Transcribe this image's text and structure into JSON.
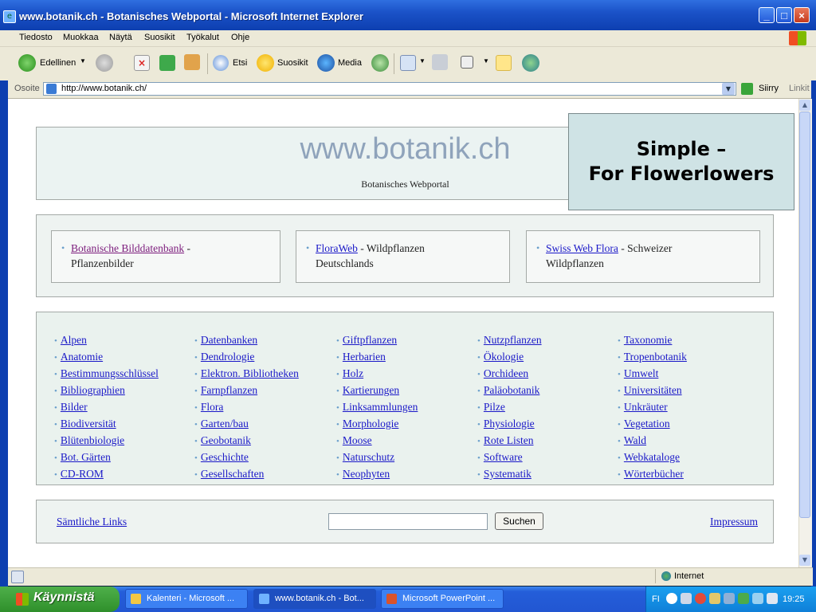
{
  "window": {
    "title": "www.botanik.ch - Botanisches Webportal - Microsoft Internet Explorer",
    "min_label": "_",
    "max_label": "□",
    "close_label": "×"
  },
  "menu": [
    "Tiedosto",
    "Muokkaa",
    "Näytä",
    "Suosikit",
    "Työkalut",
    "Ohje"
  ],
  "toolbar": {
    "back_label": "Edellinen",
    "search_label": "Etsi",
    "favorites_label": "Suosikit",
    "media_label": "Media"
  },
  "address": {
    "label": "Osoite",
    "url": "http://www.botanik.ch/",
    "go_label": "Siirry",
    "links_label": "Linkit"
  },
  "page": {
    "site_title": "www.botanik.ch",
    "site_subtitle": "Botanisches Webportal",
    "features": [
      {
        "link": "Botanische Bilddatenbank",
        "rest": " - ",
        "line2": "Pflanzenbilder",
        "visited": true
      },
      {
        "link": "FloraWeb",
        "rest": " - Wildpflanzen",
        "line2": "Deutschlands",
        "visited": false
      },
      {
        "link": "Swiss Web Flora",
        "rest": " - Schweizer",
        "line2": "Wildpflanzen",
        "visited": false
      }
    ],
    "link_columns": [
      [
        "Alpen",
        "Anatomie",
        "Bestimmungsschlüssel",
        "Bibliographien",
        "Bilder",
        "Biodiversität",
        "Blütenbiologie",
        "Bot. Gärten",
        "CD-ROM"
      ],
      [
        "Datenbanken",
        "Dendrologie",
        "Elektron. Bibliotheken",
        "Farnpflanzen",
        "Flora",
        "Garten/bau",
        "Geobotanik",
        "Geschichte",
        "Gesellschaften"
      ],
      [
        "Giftpflanzen",
        "Herbarien",
        "Holz",
        "Kartierungen",
        "Linksammlungen",
        "Morphologie",
        "Moose",
        "Naturschutz",
        "Neophyten"
      ],
      [
        "Nutzpflanzen",
        "Ökologie",
        "Orchideen",
        "Paläobotanik",
        "Pilze",
        "Physiologie",
        "Rote Listen",
        "Software",
        "Systematik"
      ],
      [
        "Taxonomie",
        "Tropenbotanik",
        "Umwelt",
        "Universitäten",
        "Unkräuter",
        "Vegetation",
        "Wald",
        "Webkataloge",
        "Wörterbücher"
      ]
    ],
    "footer_left": "Sämtliche Links",
    "search_button": "Suchen",
    "search_value": "",
    "footer_right": "Impressum"
  },
  "callout": {
    "line1": "Simple –",
    "line2": "For Flowerlowers"
  },
  "status": {
    "zone": "Internet"
  },
  "taskbar": {
    "start_label": "Käynnistä",
    "tasks": [
      "Kalenteri - Microsoft ...",
      "www.botanik.ch - Bot...",
      "Microsoft PowerPoint ..."
    ],
    "lang": "FI",
    "clock": "19:25"
  },
  "colors": {
    "link": "#1a18c8",
    "visited": "#7b1a7b",
    "title_bar": "#1b52c8",
    "panel_bg": "#eaf2ee",
    "callout_bg": "#cfe3e5"
  }
}
